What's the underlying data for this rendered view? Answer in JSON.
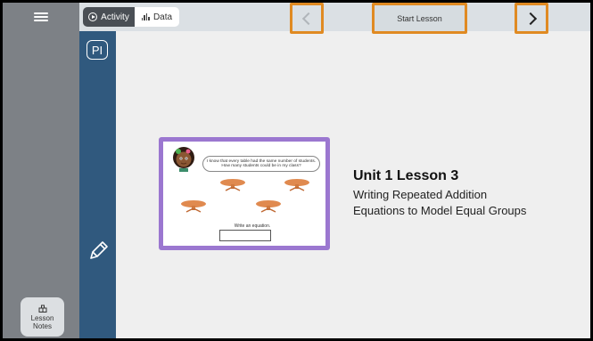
{
  "topbar": {
    "tabs": [
      {
        "label": "Activity",
        "icon": "play-circle-icon",
        "active": true
      },
      {
        "label": "Data",
        "icon": "bar-chart-icon",
        "active": false
      }
    ],
    "start_lesson_label": "Start Lesson"
  },
  "toolrail": {
    "pi_label": "PI"
  },
  "sidebar": {
    "lesson_notes_line1": "Lesson",
    "lesson_notes_line2": "Notes"
  },
  "card": {
    "speech_line1": "I know that every table had the same number of students.",
    "speech_line2": "How many students could be in my class?",
    "prompt": "Write an equation."
  },
  "lesson": {
    "title": "Unit 1 Lesson 3",
    "subtitle_line1": "Writing Repeated Addition",
    "subtitle_line2": "Equations to Model Equal Groups"
  },
  "colors": {
    "rail_blue": "#30597e",
    "card_purple": "#9b77d0",
    "highlight_orange": "#e08a22",
    "table_orange": "#e08a4f"
  }
}
